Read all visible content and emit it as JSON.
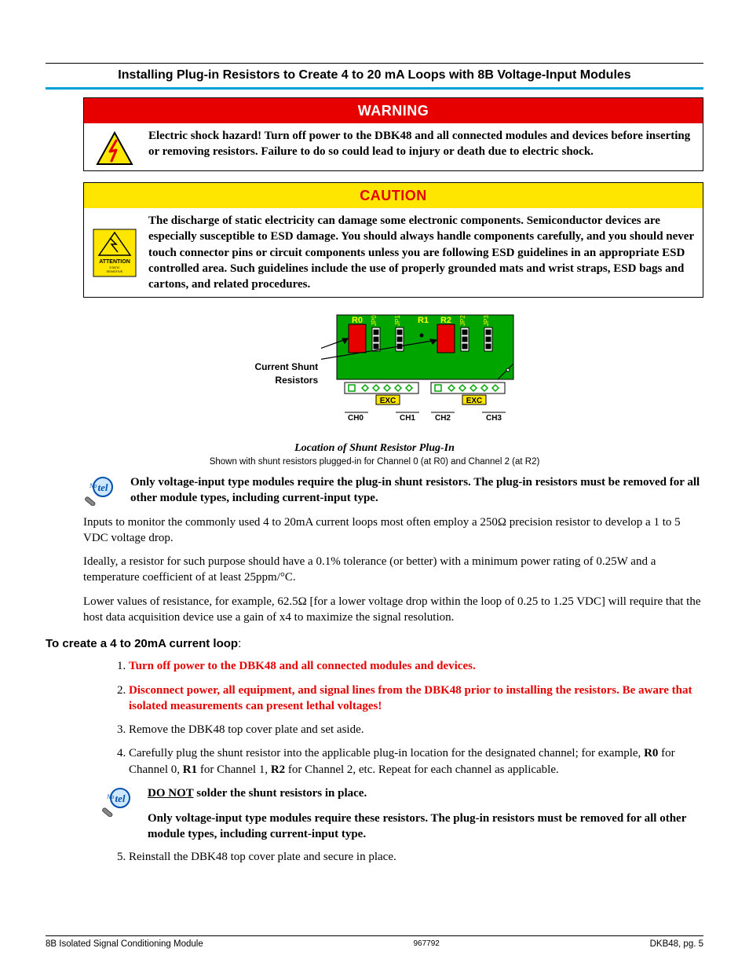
{
  "section_title": "Installing Plug-in Resistors to Create 4 to 20 mA Loops with 8B Voltage-Input Modules",
  "warning": {
    "head": "WARNING",
    "text": "Electric shock hazard!  Turn off power to the DBK48 and all connected modules and devices before inserting or removing resistors.  Failure to do so could lead to injury or death due to electric shock."
  },
  "caution": {
    "head": "CAUTION",
    "text": "The discharge of static electricity can damage some electronic components.  Semiconductor devices are especially susceptible to ESD damage.  You should always handle components carefully, and you should never touch connector pins or circuit components unless you are following ESD guidelines in an appropriate ESD controlled area.  Such guidelines include the use of properly grounded mats and wrist straps, ESD bags and cartons, and related procedures."
  },
  "diagram": {
    "pointer_label": "Current Shunt Resistors",
    "r_labels": [
      "R0",
      "R1",
      "R2"
    ],
    "exc_label": "EXC",
    "ch_labels": [
      "CH0",
      "CH1",
      "CH2",
      "CH3"
    ],
    "jp_labels": [
      "JP0",
      "JP1",
      "JP2",
      "JP3"
    ],
    "caption": "Location of Shunt Resistor Plug-In",
    "sub": "Shown with shunt resistors plugged-in for Channel 0 (at R0) and Channel 2 (at R2)"
  },
  "note1": "Only voltage-input type modules require the plug-in shunt resistors.  The plug-in resistors must be removed for all other module types, including current-input type.",
  "para1": "Inputs to monitor the commonly used 4 to 20mA current loops most often employ a 250Ω precision resistor to develop a 1 to 5 VDC voltage drop.",
  "para2": "Ideally, a resistor for such purpose should have a 0.1% tolerance (or better) with a minimum power rating of 0.25W and a temperature coefficient of at least 25ppm/°C.",
  "para3": "Lower values of resistance, for example, 62.5Ω [for a lower voltage drop within the loop of 0.25 to 1.25 VDC] will require that the host data acquisition device use a gain of x4 to maximize the signal resolution.",
  "subhead": "To create a 4 to 20mA current loop",
  "steps": {
    "s1": "Turn off power to the DBK48 and all connected modules and devices.",
    "s2": "Disconnect power, all equipment, and signal lines from the DBK48 prior to installing the resistors.  Be aware that isolated measurements can present lethal voltages!",
    "s3": "Remove the DBK48 top cover plate and set aside.",
    "s4_pre": "Carefully plug the shunt resistor into the applicable plug-in location for the designated channel; for example, ",
    "s4_r0": "R0",
    "s4_mid1": " for Channel 0, ",
    "s4_r1": "R1",
    "s4_mid2": " for Channel 1, ",
    "s4_r2": "R2",
    "s4_post": " for Channel 2, etc.  Repeat for each channel as applicable.",
    "s5": "Reinstall the DBK48 top cover plate and secure in place."
  },
  "note2a_pre": "DO NOT",
  "note2a_post": " solder the shunt resistors in place.",
  "note2b": "Only voltage-input type modules require these resistors.  The plug-in resistors must be removed for all other module types, including current-input type.",
  "footer": {
    "left": "8B Isolated Signal Conditioning Module",
    "mid": "967792",
    "right": "DKB48, pg. 5"
  }
}
